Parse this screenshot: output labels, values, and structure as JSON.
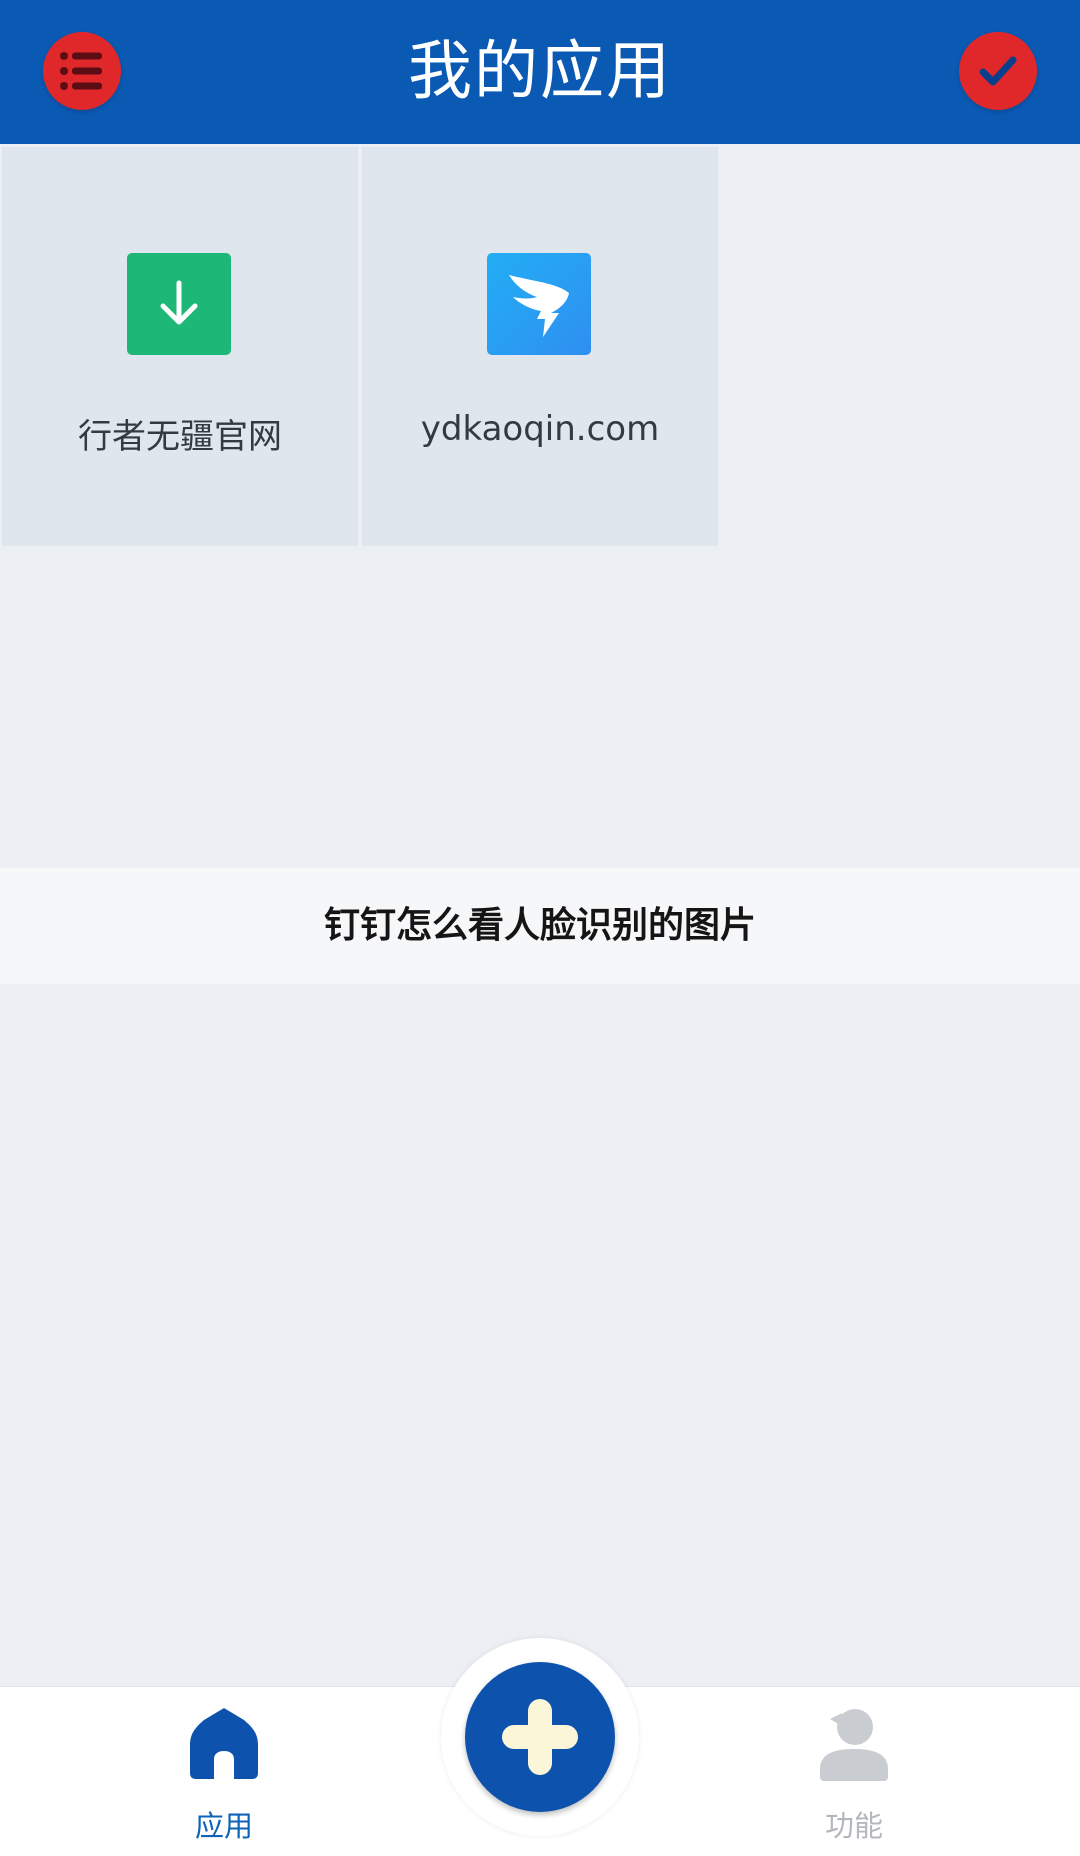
{
  "header": {
    "title": "我的应用",
    "menu_icon": "list-menu-icon",
    "confirm_icon": "checkmark-icon",
    "button_color": "#e0282b",
    "background_color": "#0a59b3"
  },
  "apps": [
    {
      "label": "行者无疆官网",
      "icon": "download-arrow-icon",
      "icon_color": "#1db877"
    },
    {
      "label": "ydkaoqin.com",
      "icon": "dingtalk-wing-icon",
      "icon_color": "#22aef5"
    }
  ],
  "banner": {
    "text": "钉钉怎么看人脸识别的图片"
  },
  "bottom_nav": {
    "items": [
      {
        "label": "应用",
        "icon": "home-icon",
        "active": true,
        "color": "#0d63b8"
      },
      {
        "label": "功能",
        "icon": "user-icon",
        "active": false,
        "color": "#b4b8bd"
      }
    ],
    "fab_icon": "plus-icon",
    "fab_color": "#0d52ad"
  }
}
